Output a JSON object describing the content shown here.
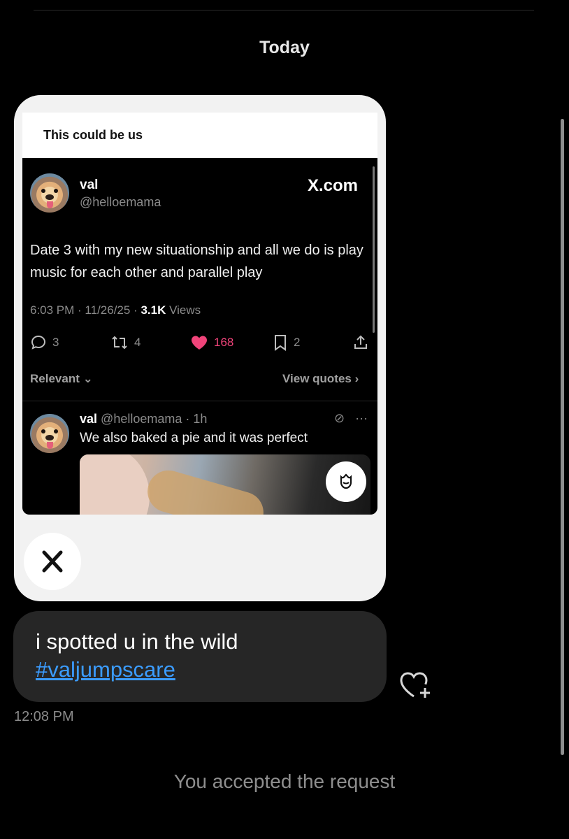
{
  "header": {
    "date_label": "Today"
  },
  "shared_post": {
    "caption": "This could be us",
    "source": "X.com",
    "author_name": "val",
    "author_handle": "@helloemama",
    "text": "Date 3 with my new situationship and all we do is play music for each other and parallel play",
    "meta_time": "6:03 PM · 11/26/25 · ",
    "meta_views_count": "3.1K",
    "meta_views_label": " Views",
    "actions": {
      "replies": "3",
      "reposts": "4",
      "likes": "168",
      "bookmarks": "2"
    },
    "sort_label": "Relevant",
    "view_quotes_label": "View quotes",
    "reply": {
      "name": "val",
      "handle_time": "@helloemama · 1h",
      "text": "We also baked a pie and it was perfect"
    },
    "icons": [
      "reply-icon",
      "repost-icon",
      "heart-icon",
      "bookmark-icon",
      "share-icon",
      "grok-icon",
      "more-icon",
      "gift-icon",
      "x-logo-icon"
    ],
    "like_color": "#f0447a"
  },
  "message": {
    "line1": "i spotted u in the wild",
    "hashtag": "#valjumpscare",
    "time": "12:08 PM",
    "link_color": "#3b9cff"
  },
  "footer": {
    "note": "You accepted the request"
  }
}
